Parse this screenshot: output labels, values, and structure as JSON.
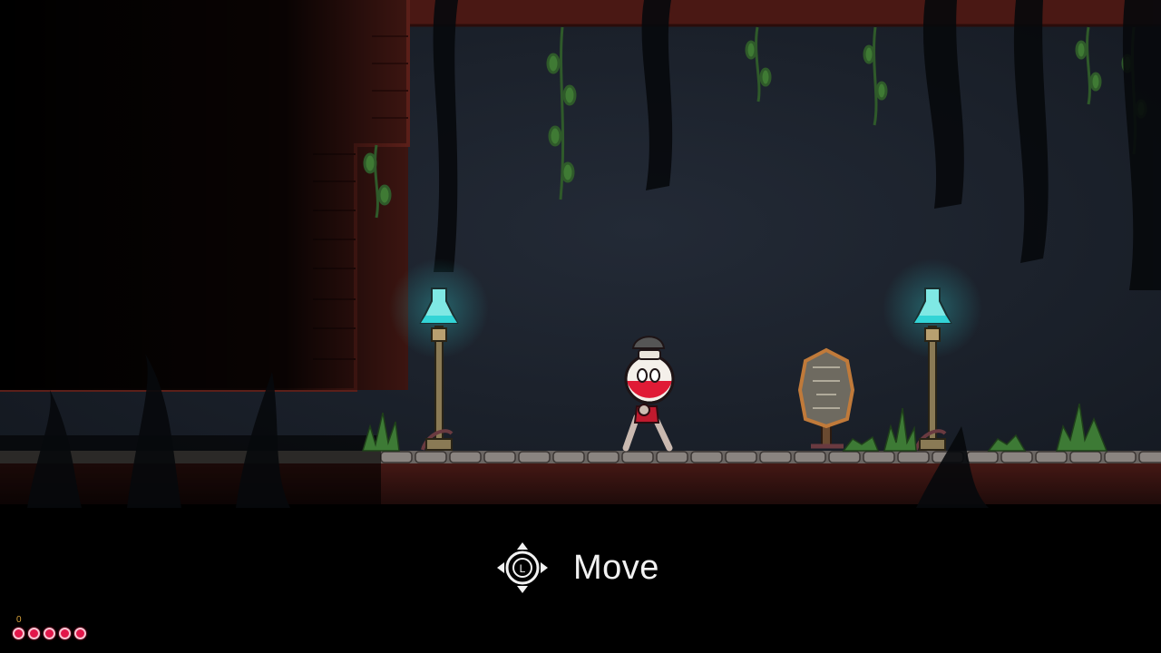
{
  "prompt": {
    "icon": "left-stick-move-icon",
    "stick_letter": "L",
    "label": "Move"
  },
  "hud": {
    "count": "0",
    "health_total": 5,
    "health_filled": 5
  },
  "colors": {
    "background": "#1a2029",
    "brick": "#5b1f19",
    "lamp_glow": "#33d4d6",
    "player_red": "#e01b36",
    "heart": "#e2164a",
    "counter": "#d9a23a"
  },
  "icons": [
    "flask-lamp-icon",
    "stone-tablet-icon",
    "hanging-vine-icon",
    "grass-tuft-icon"
  ]
}
